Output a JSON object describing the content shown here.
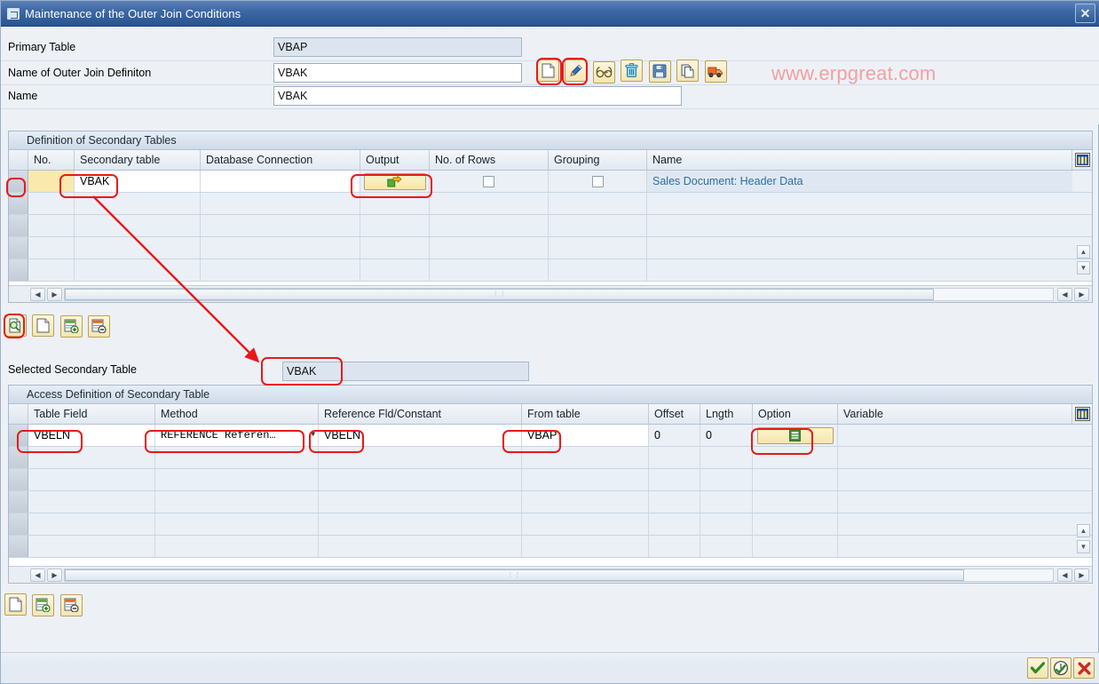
{
  "window": {
    "title": "Maintenance of the Outer Join Conditions",
    "close_label": "✕",
    "icon_name": "dialog-window-icon"
  },
  "watermark": {
    "text": "www.erpgreat.com",
    "color": "#f4a0a0"
  },
  "form": {
    "rows": [
      {
        "label": "Primary Table",
        "value": "VBAP",
        "readonly": true
      },
      {
        "label": "Name of Outer Join Definiton",
        "value": "VBAK",
        "readonly": false
      },
      {
        "label": "Name",
        "value": "VBAK",
        "readonly": false
      }
    ]
  },
  "header_toolbar": {
    "buttons": [
      {
        "name": "create-button",
        "icon": "new-document-icon",
        "title": "Create"
      },
      {
        "name": "change-button",
        "icon": "pencil-edit-icon",
        "title": "Change"
      },
      {
        "name": "display-button",
        "icon": "glasses-display-icon",
        "title": "Display"
      },
      {
        "name": "delete-button",
        "icon": "trash-delete-icon",
        "title": "Delete"
      },
      {
        "name": "save-button",
        "icon": "floppy-save-icon",
        "title": "Save"
      },
      {
        "name": "copy-button",
        "icon": "copy-document-icon",
        "title": "Copy"
      },
      {
        "name": "transport-button",
        "icon": "transport-truck-icon",
        "title": "Transport"
      }
    ]
  },
  "secondary_tables": {
    "panel_title": "Definition of Secondary Tables",
    "columns": [
      "No.",
      "Secondary table",
      "Database Connection",
      "Output",
      "No. of Rows",
      "Grouping",
      "Name"
    ],
    "rows": [
      {
        "no": "",
        "secondary_table": "VBAK",
        "database_connection": "",
        "output_icon": "output-export-icon",
        "no_of_rows_checked": false,
        "grouping_checked": false,
        "name": "Sales Document: Header Data"
      }
    ],
    "empty_row_count": 4,
    "settings_icon": "table-settings-icon"
  },
  "grid_toolbar_1": {
    "buttons": [
      {
        "name": "details-button",
        "icon": "magnifier-document-icon"
      },
      {
        "name": "new-entry-button",
        "icon": "new-document-icon"
      },
      {
        "name": "insert-row-button",
        "icon": "insert-row-icon"
      },
      {
        "name": "delete-row-button",
        "icon": "delete-row-icon"
      }
    ]
  },
  "selected_secondary_table": {
    "label": "Selected Secondary Table",
    "value": "VBAK"
  },
  "access_definition": {
    "panel_title": "Access Definition of Secondary Table",
    "columns": [
      "Table Field",
      "Method",
      "Reference Fld/Constant",
      "From table",
      "Offset",
      "Lngth",
      "Option",
      "Variable"
    ],
    "rows": [
      {
        "table_field": "VBELN",
        "method": "REFERENCE Referen…",
        "method_has_dropdown": true,
        "reference_fld": "VBELN",
        "from_table": "VBAP",
        "offset": "0",
        "lngth": "0",
        "option_icon": "equals-option-icon",
        "variable": ""
      }
    ],
    "empty_row_count": 5,
    "settings_icon": "table-settings-icon"
  },
  "grid_toolbar_2": {
    "buttons": [
      {
        "name": "new-entry-button",
        "icon": "new-document-icon"
      },
      {
        "name": "insert-row-button",
        "icon": "insert-row-icon"
      },
      {
        "name": "delete-row-button",
        "icon": "delete-row-icon"
      }
    ]
  },
  "footer": {
    "buttons": [
      {
        "name": "confirm-button",
        "icon": "green-check-icon"
      },
      {
        "name": "check-entries-button",
        "icon": "clock-check-icon"
      },
      {
        "name": "cancel-button",
        "icon": "red-cross-icon"
      }
    ]
  },
  "annotations": {
    "color": "#e8191b",
    "note": "red callout boxes and arrow highlighting create/change buttons, VBAK cell, output button, selected table and access definition fields"
  }
}
